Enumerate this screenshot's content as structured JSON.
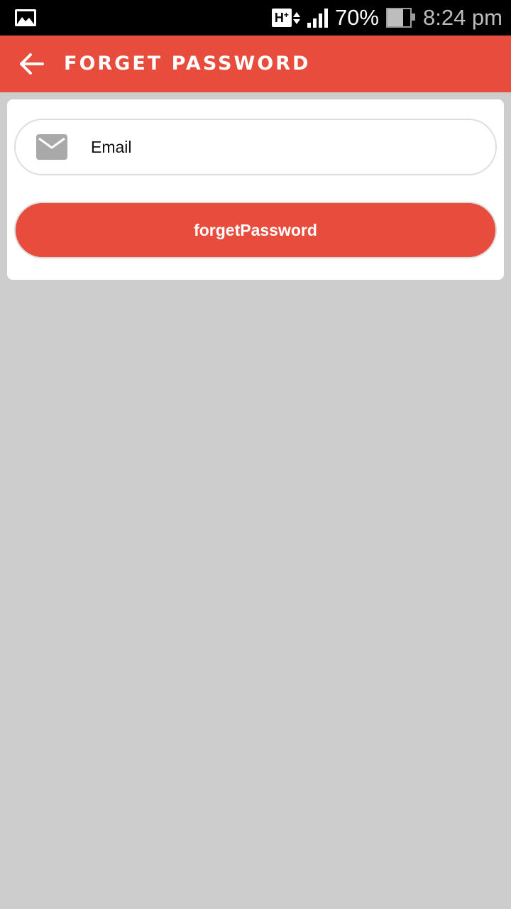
{
  "status_bar": {
    "network_type": "H",
    "battery_percent": "70%",
    "battery_level": 0.7,
    "time": "8:24 pm",
    "icons": [
      "gallery-icon",
      "network-hplus-icon",
      "data-activity-icon",
      "signal-icon",
      "battery-icon"
    ]
  },
  "app_bar": {
    "title": "Forget Password",
    "back_icon": "arrow-left-icon",
    "color": "#e74c3c"
  },
  "form": {
    "email_placeholder": "Email",
    "email_value": "",
    "email_icon": "mail-icon",
    "submit_label": "forgetPassword",
    "submit_color": "#e74c3c"
  },
  "colors": {
    "primary": "#e74c3c",
    "background": "#cdcdcd",
    "card": "#ffffff"
  }
}
